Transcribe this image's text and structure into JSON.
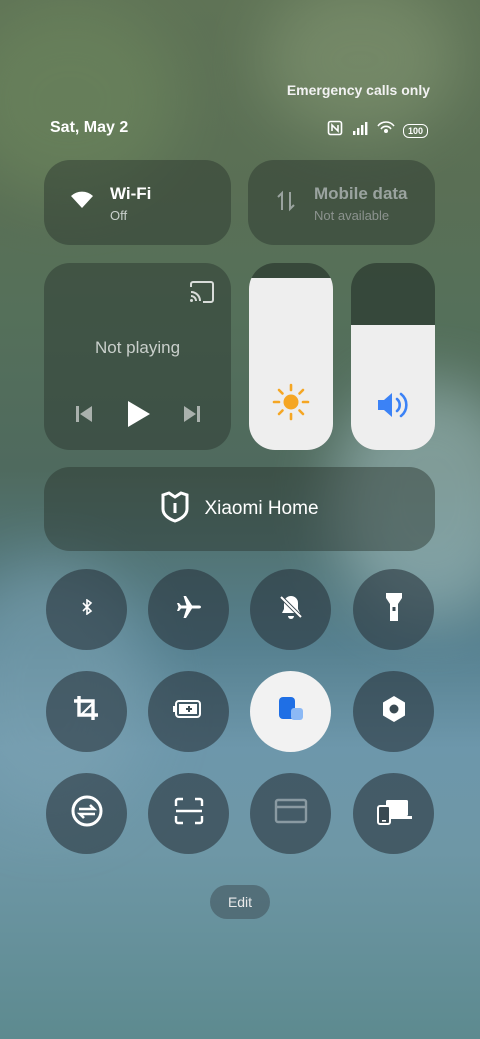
{
  "status": {
    "network_text": "Emergency calls only",
    "date": "Sat, May 2",
    "battery": "100",
    "icons": [
      "nfc-icon",
      "signal-icon",
      "hotspot-icon",
      "battery-icon"
    ]
  },
  "tiles": {
    "wifi": {
      "title": "Wi-Fi",
      "subtitle": "Off",
      "icon": "wifi-icon"
    },
    "mobile_data": {
      "title": "Mobile data",
      "subtitle": "Not available",
      "icon": "data-arrows-icon"
    }
  },
  "media": {
    "status": "Not playing",
    "icons": [
      "cast-icon",
      "previous-icon",
      "play-icon",
      "next-icon"
    ]
  },
  "sliders": {
    "brightness": {
      "icon": "sun-icon",
      "level": 0.92,
      "color": "#f5a623"
    },
    "volume": {
      "icon": "speaker-icon",
      "level": 0.67,
      "color": "#3b82f6"
    }
  },
  "smart_home": {
    "label": "Xiaomi Home",
    "icon": "mi-home-icon"
  },
  "toggles": [
    {
      "name": "bluetooth",
      "icon": "bluetooth-icon",
      "active": false
    },
    {
      "name": "airplane-mode",
      "icon": "airplane-icon",
      "active": false
    },
    {
      "name": "silent",
      "icon": "bell-off-icon",
      "active": false
    },
    {
      "name": "flashlight",
      "icon": "flashlight-icon",
      "active": false
    },
    {
      "name": "screenshot-crop",
      "icon": "crop-icon",
      "active": false
    },
    {
      "name": "battery-saver",
      "icon": "battery-saver-icon",
      "active": false
    },
    {
      "name": "floating-window",
      "icon": "floating-window-icon",
      "active": true
    },
    {
      "name": "settings-hex",
      "icon": "hex-nut-icon",
      "active": false
    },
    {
      "name": "sync",
      "icon": "sync-icon",
      "active": false
    },
    {
      "name": "scanner",
      "icon": "scan-icon",
      "active": false
    },
    {
      "name": "card",
      "icon": "card-icon",
      "active": false
    },
    {
      "name": "cast-device",
      "icon": "devices-icon",
      "active": false
    }
  ],
  "edit_label": "Edit"
}
